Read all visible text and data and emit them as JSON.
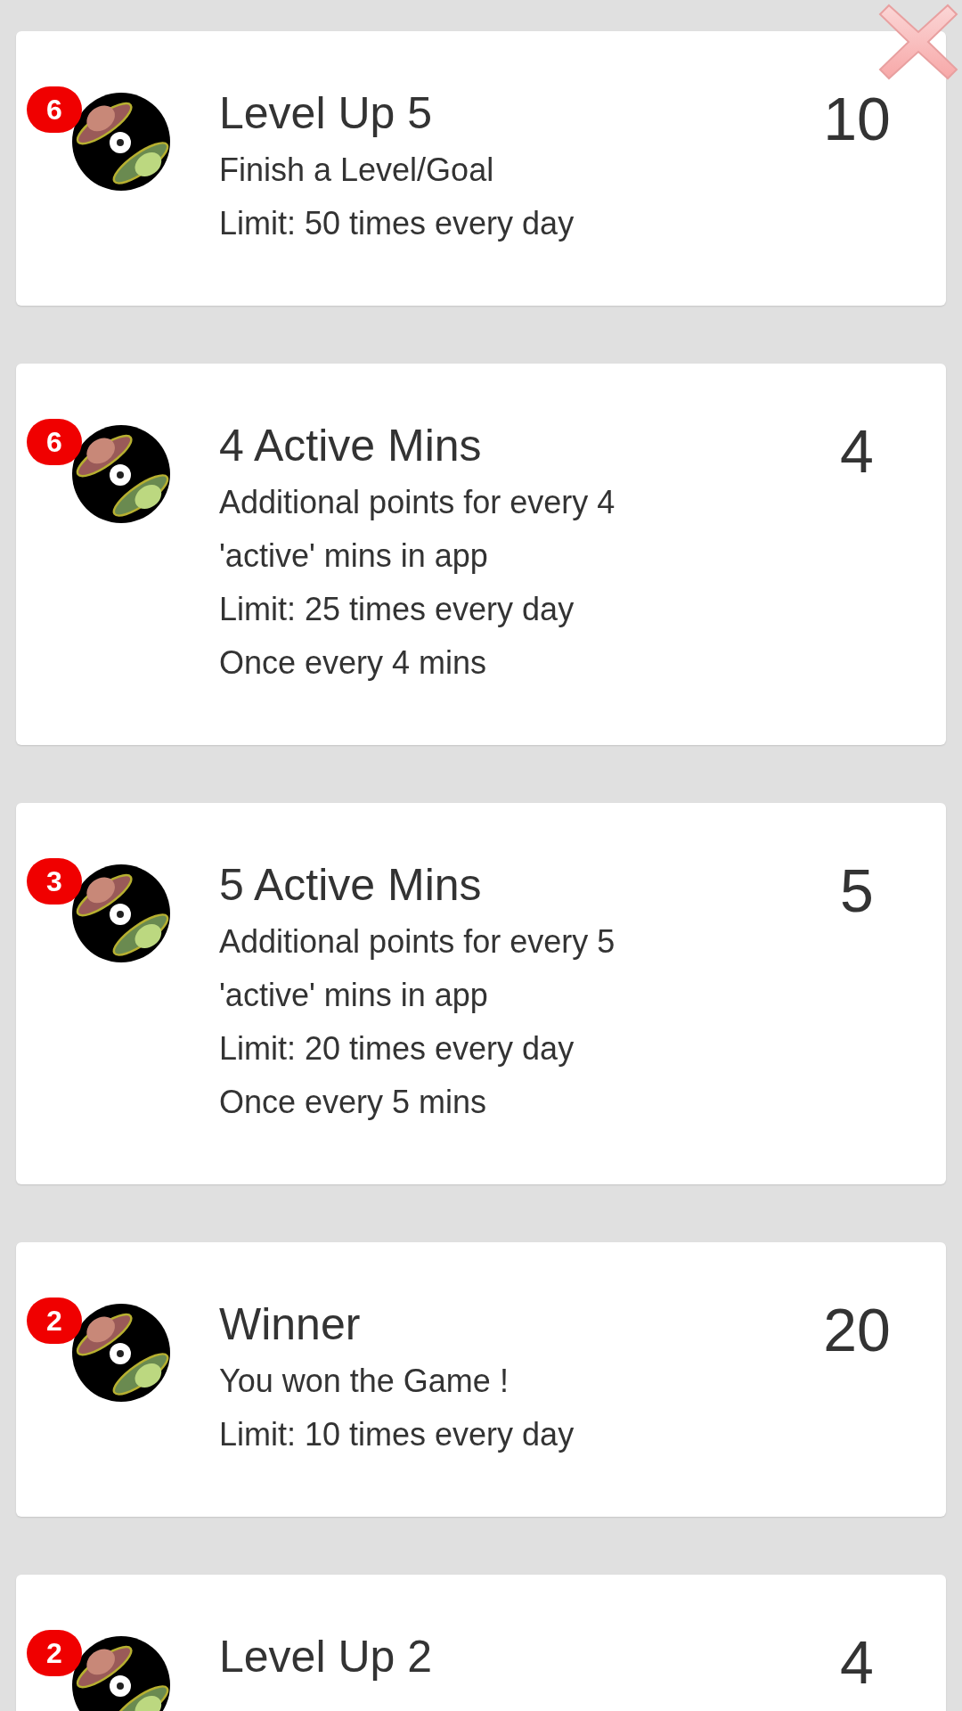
{
  "rewards": [
    {
      "count": "6",
      "title": "Level Up 5",
      "lines": [
        "Finish a Level/Goal",
        "Limit: 50 times every day"
      ],
      "points": "10"
    },
    {
      "count": "6",
      "title": "4 Active Mins",
      "lines": [
        "Additional points for every 4",
        "'active' mins in app",
        "Limit: 25 times every day",
        "Once every 4 mins"
      ],
      "points": "4"
    },
    {
      "count": "3",
      "title": "5 Active Mins",
      "lines": [
        "Additional points for every 5",
        "'active' mins in app",
        "Limit: 20 times every day",
        "Once every 5 mins"
      ],
      "points": "5"
    },
    {
      "count": "2",
      "title": "Winner",
      "lines": [
        "You won the Game !",
        "Limit: 10 times every day"
      ],
      "points": "20"
    },
    {
      "count": "2",
      "title": "Level Up 2",
      "points": "4"
    }
  ]
}
